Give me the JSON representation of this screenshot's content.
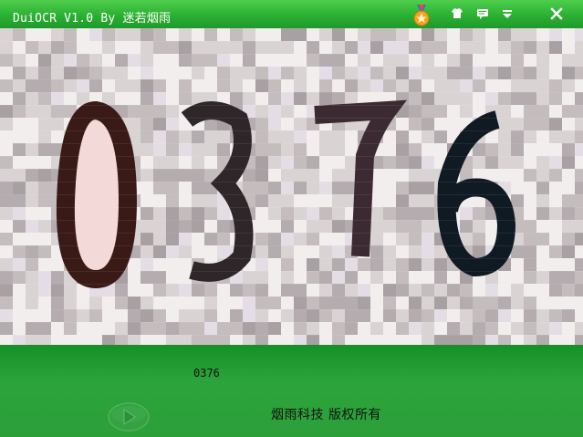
{
  "window": {
    "title": "DuiOCR V1.0 By 迷若烟雨"
  },
  "titlebar_icons": [
    "medal-icon",
    "skin-shirt-icon",
    "message-icon",
    "menu-dropdown-icon",
    "close-icon"
  ],
  "captcha": {
    "digits": [
      "0",
      "3",
      "7",
      "6"
    ]
  },
  "result": {
    "text": "0376"
  },
  "footer": {
    "copyright": "烟雨科技 版权所有"
  },
  "colors": {
    "title_green": "#2bb033",
    "bottom_green": "#2ca43c",
    "play_button": "#3fa04a"
  }
}
